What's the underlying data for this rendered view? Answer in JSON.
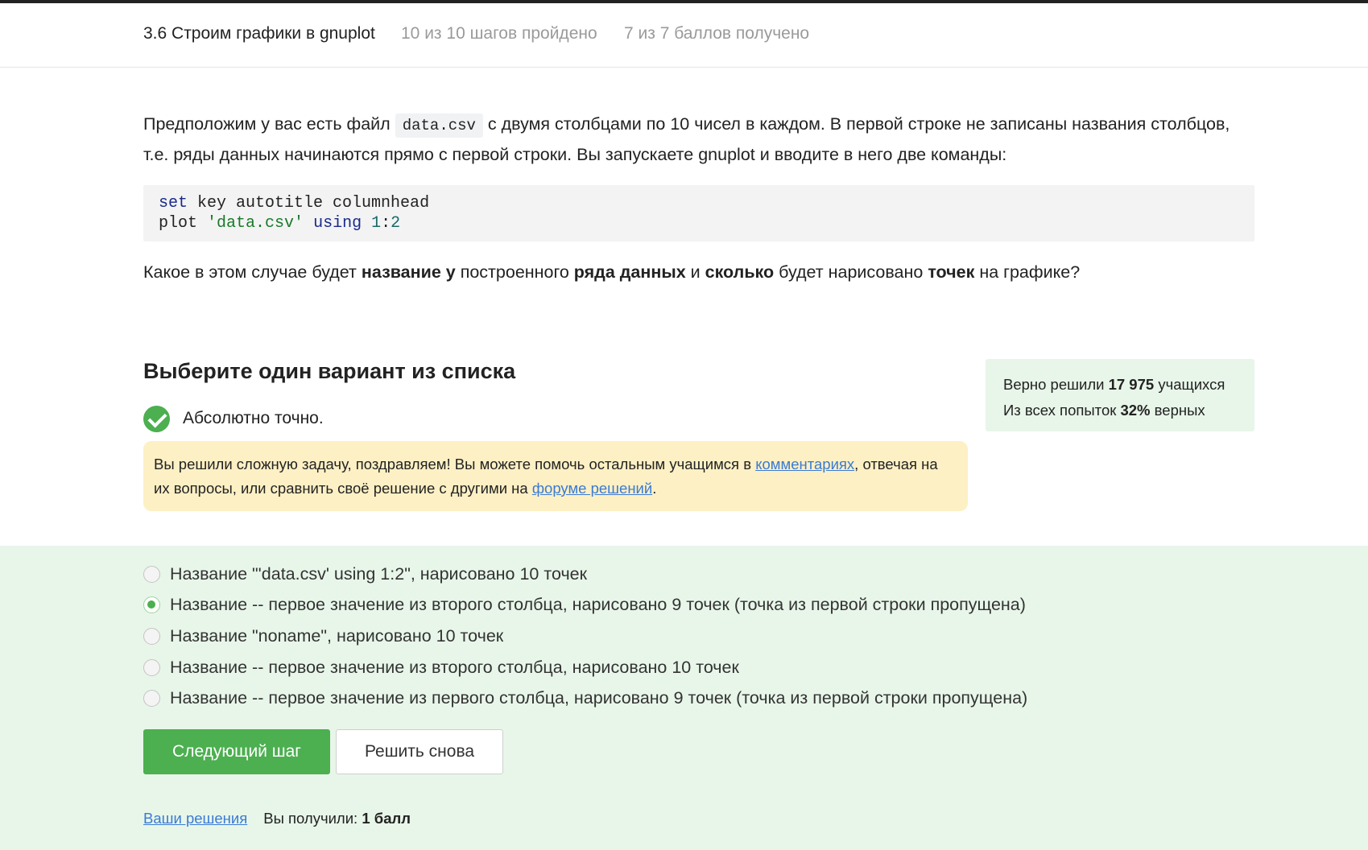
{
  "header": {
    "title": "3.6 Строим графики в gnuplot",
    "steps_progress": "10 из 10 шагов пройдено",
    "points_progress": "7 из 7 баллов  получено"
  },
  "step": {
    "intro_before_code": "Предположим у вас есть файл ",
    "inline_code": "data.csv",
    "intro_after_code": " с двумя столбцами по 10 чисел в каждом. В первой строке не записаны названия столбцов, т.е. ряды данных начинаются прямо с первой строки. Вы запускаете gnuplot и вводите в него две команды:",
    "code_line1": {
      "kw": "set",
      "rest": " key autotitle columnhead"
    },
    "code_line2": {
      "cmd": "plot ",
      "str": "'data.csv'",
      "sp": " ",
      "kw": "using",
      "sp2": " ",
      "num1": "1",
      "colon": ":",
      "num2": "2"
    },
    "question": {
      "p1": "Какое в этом случае будет ",
      "b1": "название у",
      "p2": " построенного ",
      "b2": "ряда данных",
      "p3": " и ",
      "b3": "сколько",
      "p4": " будет нарисовано ",
      "b4": "точек",
      "p5": " на графике?"
    }
  },
  "quiz": {
    "section_title": "Выберите один вариант из списка",
    "result_text": "Абсолютно точно.",
    "notice": {
      "t1": "Вы решили сложную задачу, поздравляем! Вы можете помочь остальным учащимся в ",
      "link1": "комментариях",
      "t2": ", отвечая на их вопросы, или сравнить своё решение с другими на ",
      "link2": "форуме решений",
      "t3": "."
    },
    "stats": {
      "l1_pre": "Верно решили ",
      "l1_num": "17 975",
      "l1_post": " учащихся",
      "l2_pre": "Из всех попыток ",
      "l2_num": "32%",
      "l2_post": " верных"
    },
    "options": [
      {
        "label": "Название \"'data.csv' using 1:2\", нарисовано 10 точек",
        "checked": false
      },
      {
        "label": "Название -- первое значение из второго столбца, нарисовано 9 точек (точка из первой строки пропущена)",
        "checked": true
      },
      {
        "label": "Название \"noname\", нарисовано 10 точек",
        "checked": false
      },
      {
        "label": "Название -- первое значение из второго столбца, нарисовано 10 точек",
        "checked": false
      },
      {
        "label": "Название -- первое значение из первого столбца, нарисовано 9 точек (точка из первой строки пропущена)",
        "checked": false
      }
    ],
    "next_button": "Следующий шаг",
    "retry_button": "Решить снова",
    "footer": {
      "your_solutions": "Ваши решения",
      "received_label": "Вы получили: ",
      "received_value": "1 балл"
    }
  }
}
